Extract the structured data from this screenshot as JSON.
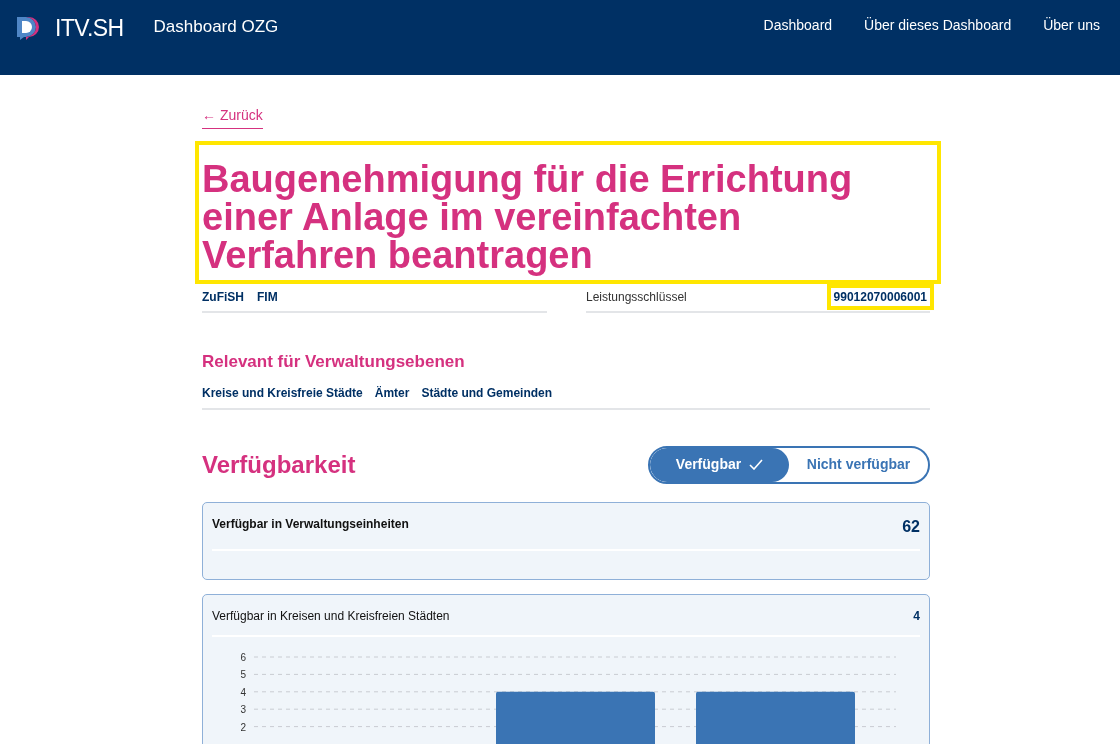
{
  "header": {
    "logo_text": "ITV.SH",
    "site_title": "Dashboard OZG",
    "nav": [
      {
        "label": "Dashboard"
      },
      {
        "label": "Über dieses Dashboard"
      },
      {
        "label": "Über uns"
      }
    ]
  },
  "back_link": "← Zurück",
  "title": {
    "text": "Baugenehmigung für die Errichtung einer Anlage im vereinfachten Verfahren beantragen",
    "highlighted": true
  },
  "meta": {
    "sources": [
      "ZuFiSH",
      "FIM"
    ],
    "key_label": "Leistungsschlüssel",
    "key_value": {
      "text": "99012070006001",
      "highlighted": true
    }
  },
  "levels": {
    "heading": "Relevant für Verwaltungsebenen",
    "items": [
      "Kreise und Kreisfreie Städte",
      "Ämter",
      "Städte und Gemeinden"
    ]
  },
  "availability": {
    "heading": "Verfügbarkeit",
    "toggle": [
      {
        "label": "Verfügbar",
        "selected": true
      },
      {
        "label": "Nicht verfügbar",
        "selected": false
      }
    ],
    "cards": [
      {
        "title": "Verfügbar in Verwaltungseinheiten",
        "count": "62",
        "bold": true
      },
      {
        "title": "Verfügbar in Kreisen und Kreisfreien Städten",
        "count": "4",
        "bold": false,
        "chart_data": {
          "type": "bar",
          "grid": true,
          "values": [
            4,
            4
          ],
          "yticks": [
            2,
            3,
            4,
            5,
            6
          ],
          "ylim": [
            0,
            6
          ]
        }
      }
    ]
  }
}
